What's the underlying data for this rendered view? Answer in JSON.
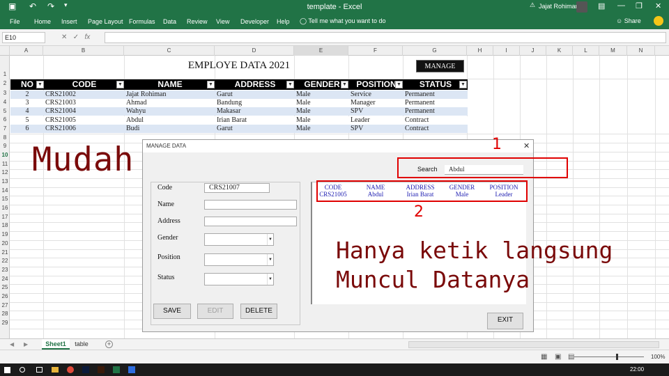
{
  "window": {
    "title": "template - Excel",
    "user_name": "Jajat Rohiman"
  },
  "ribbon": {
    "tabs": [
      "File",
      "Home",
      "Insert",
      "Page Layout",
      "Formulas",
      "Data",
      "Review",
      "View",
      "Developer",
      "Help"
    ],
    "tell_me": "Tell me what you want to do",
    "share": "Share"
  },
  "formula_bar": {
    "name_box": "E10",
    "fx": "fx",
    "value": ""
  },
  "grid": {
    "columns": [
      "A",
      "B",
      "C",
      "D",
      "E",
      "F",
      "G",
      "H",
      "I",
      "J",
      "K",
      "L",
      "M",
      "N"
    ],
    "rows": [
      "1",
      "2",
      "3",
      "4",
      "5",
      "6",
      "7",
      "8",
      "9",
      "10",
      "11",
      "12",
      "13",
      "14",
      "15",
      "16",
      "17",
      "18",
      "19",
      "20",
      "21",
      "22",
      "23",
      "24",
      "25",
      "26",
      "27",
      "28",
      "29"
    ]
  },
  "sheet": {
    "title": "EMPLOYE DATA 2021",
    "manage_button": "MANAGE",
    "headers": [
      "NO",
      "CODE",
      "NAME",
      "ADDRESS",
      "GENDER",
      "POSITION",
      "STATUS"
    ],
    "rows": [
      [
        "2",
        "CRS21002",
        "Jajat Rohiman",
        "Garut",
        "Male",
        "Service",
        "Permanent"
      ],
      [
        "3",
        "CRS21003",
        "Ahmad",
        "Bandung",
        "Male",
        "Manager",
        "Permanent"
      ],
      [
        "4",
        "CRS21004",
        "Wahyu",
        "Makasar",
        "Male",
        "SPV",
        "Permanent"
      ],
      [
        "5",
        "CRS21005",
        "Abdul",
        "Irian Barat",
        "Male",
        "Leader",
        "Contract"
      ],
      [
        "6",
        "CRS21006",
        "Budi",
        "Garut",
        "Male",
        "SPV",
        "Contract"
      ]
    ]
  },
  "overlay": {
    "headline": "Mudah Cari Data",
    "caption_line1": "Hanya ketik langsung",
    "caption_line2": "Muncul Datanya",
    "marker1": "1",
    "marker2": "2"
  },
  "dialog": {
    "title": "MANAGE DATA",
    "close": "✕",
    "fields": {
      "code_label": "Code",
      "code_value": "CRS21007",
      "name_label": "Name",
      "address_label": "Address",
      "gender_label": "Gender",
      "position_label": "Position",
      "status_label": "Status"
    },
    "buttons": {
      "save": "SAVE",
      "edit": "EDIT",
      "delete": "DELETE",
      "exit": "EXIT"
    },
    "search": {
      "label": "Search",
      "value": "Abdul"
    },
    "results": {
      "headers": [
        "CODE",
        "NAME",
        "ADDRESS",
        "GENDER",
        "POSITION"
      ],
      "row": [
        "CRS21005",
        "Abdul",
        "Irian Barat",
        "Male",
        "Leader"
      ]
    }
  },
  "sheet_tabs": {
    "active": "Sheet1",
    "other": "table",
    "add": "+"
  },
  "status_bar": {
    "zoom": "100%"
  },
  "taskbar": {
    "clock": "22:00"
  },
  "colors": {
    "excel_green": "#217346",
    "overlay_text": "#7a0a0a",
    "highlight_red": "#e00000",
    "result_text": "#1a1ab0",
    "table_band": "#dce6f4"
  }
}
